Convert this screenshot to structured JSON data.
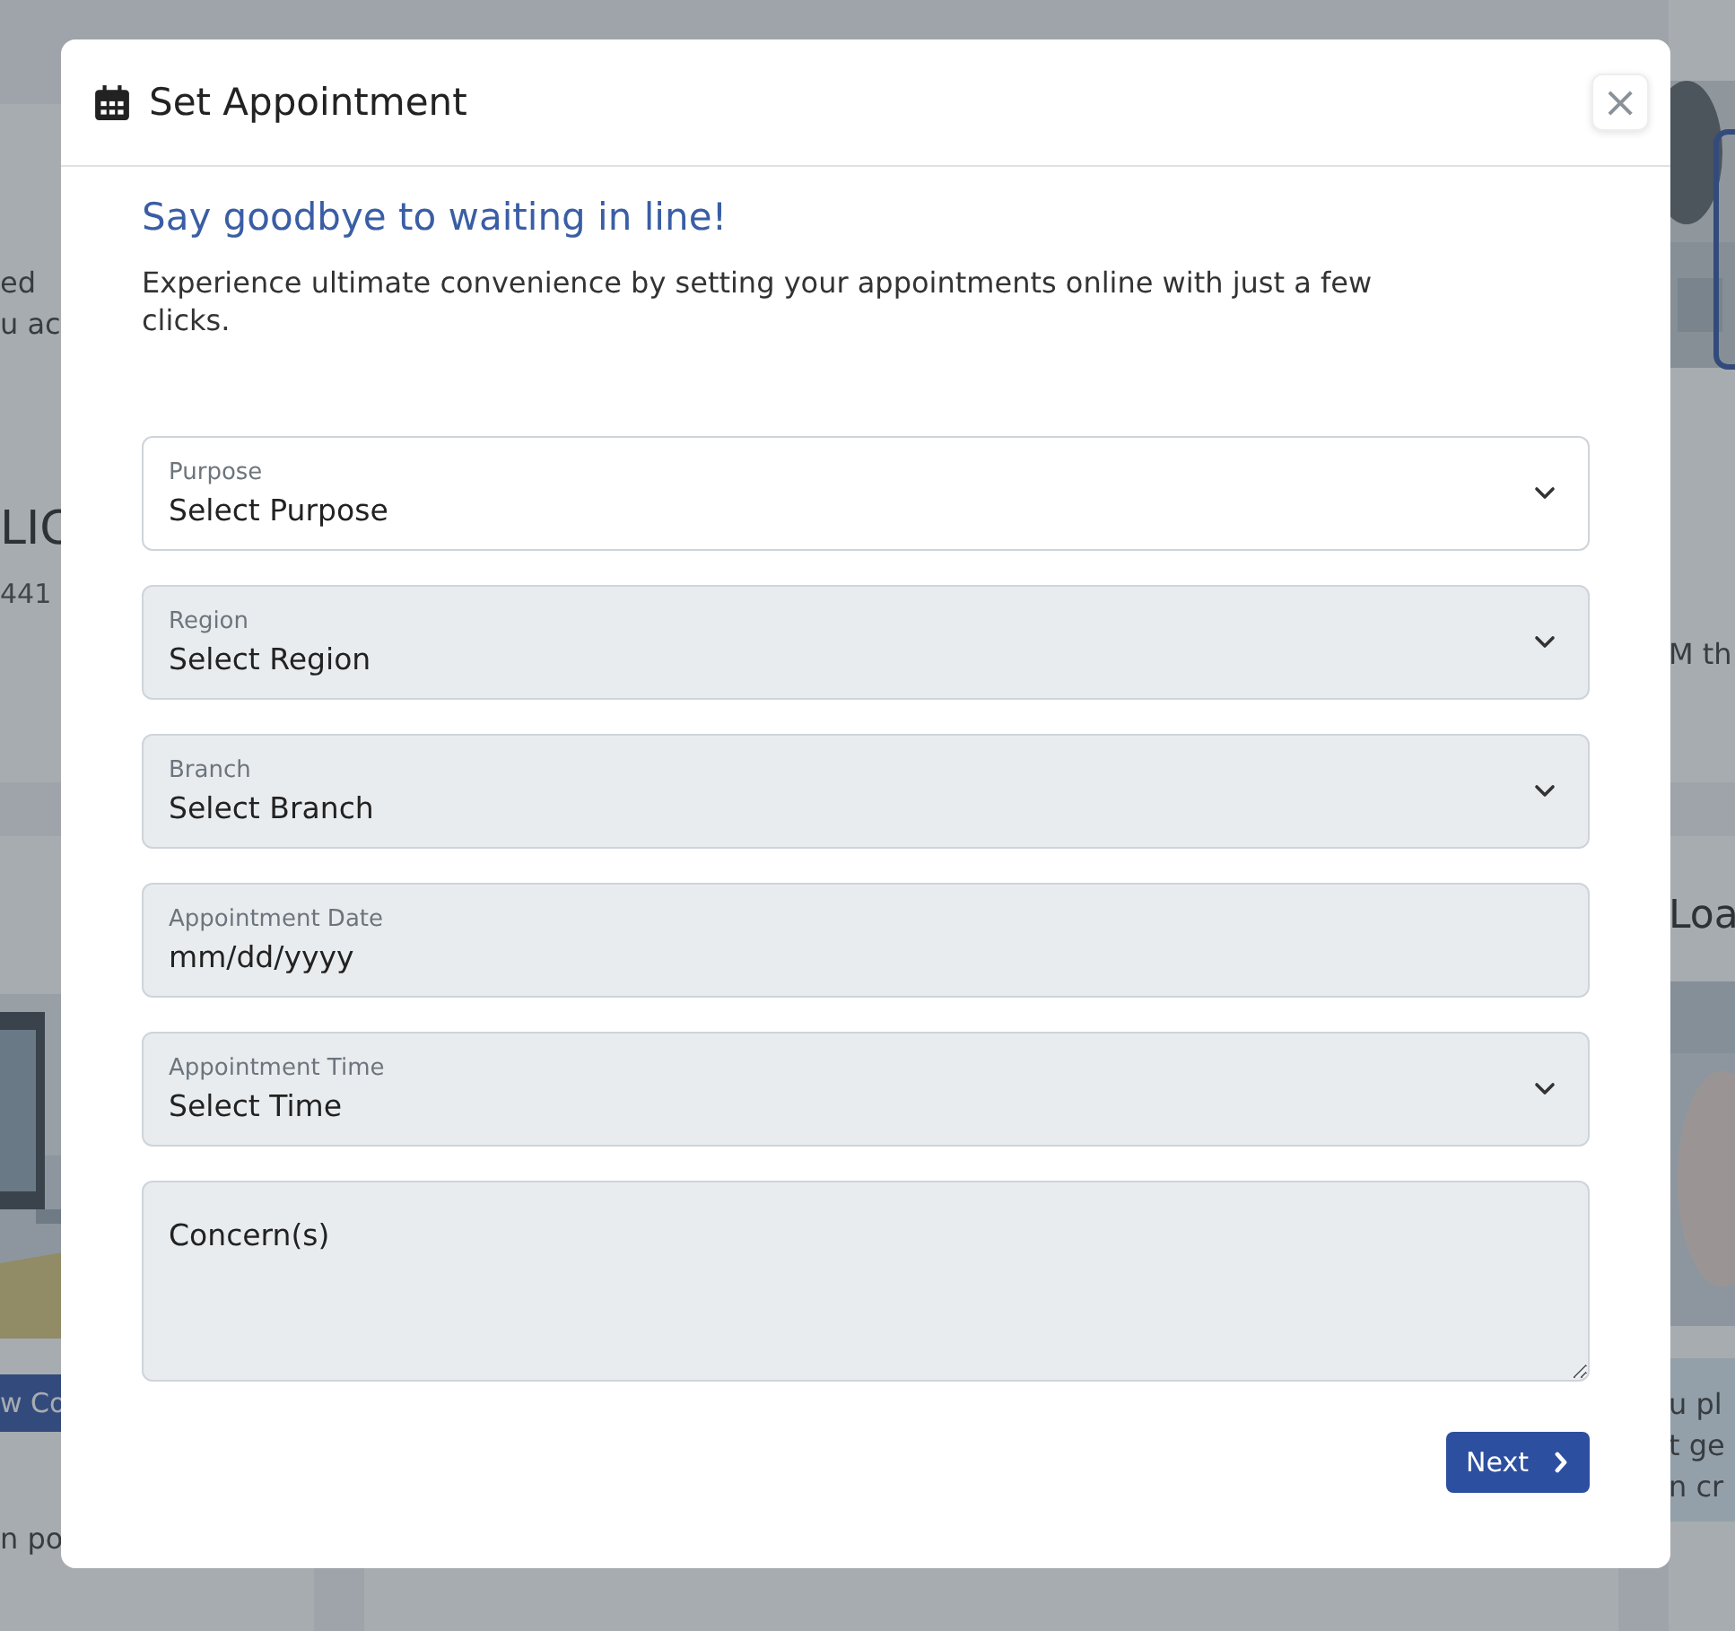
{
  "background": {
    "left_lines": [
      "ed",
      "u ac"
    ],
    "left_heading": "LIC",
    "left_number": "441",
    "left_button": "w Co",
    "left_footer": "n po",
    "right_text": "M th",
    "right_heading": "Loa",
    "right_lines": [
      "u pl",
      "t ge",
      "n cr"
    ]
  },
  "dialog": {
    "title": "Set Appointment",
    "close": "×",
    "heading": "Say goodbye to waiting in line!",
    "intro": "Experience ultimate convenience by setting your appointments online with just a few clicks.",
    "fields": [
      {
        "kind": "select",
        "label": "Purpose",
        "value": "Select Purpose",
        "disabled": false
      },
      {
        "kind": "select",
        "label": "Region",
        "value": "Select Region",
        "disabled": true
      },
      {
        "kind": "select",
        "label": "Branch",
        "value": "Select Branch",
        "disabled": true
      },
      {
        "kind": "date",
        "label": "Appointment Date",
        "value": "mm/dd/yyyy",
        "disabled": true
      },
      {
        "kind": "select",
        "label": "Appointment Time",
        "value": "Select Time",
        "disabled": true
      },
      {
        "kind": "textarea",
        "placeholder": "Concern(s)",
        "disabled": true
      }
    ],
    "next_button": "Next"
  }
}
